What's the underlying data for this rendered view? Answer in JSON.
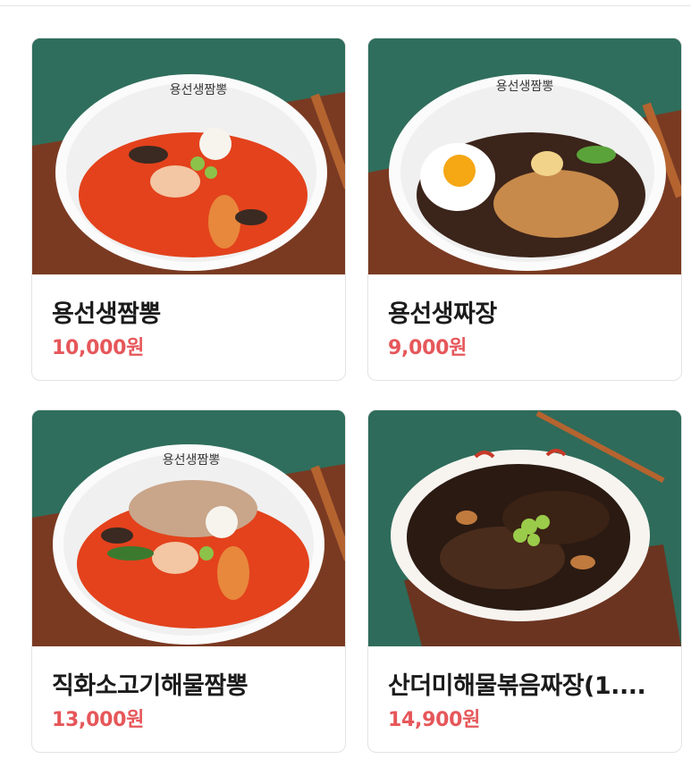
{
  "menu": {
    "items": [
      {
        "name": "용선생짬뽕",
        "price": "10,000원",
        "image": "jjamppong-bowl-image",
        "bowl_logo": "용선생짬뽕"
      },
      {
        "name": "용선생짜장",
        "price": "9,000원",
        "image": "jjajang-bowl-image",
        "bowl_logo": "용선생짬뽕"
      },
      {
        "name": "직화소고기해물짬뽕",
        "price": "13,000원",
        "image": "beef-seafood-jjamppong-image",
        "bowl_logo": "용선생짬뽕"
      },
      {
        "name": "산더미해물볶음짜장(1....",
        "price": "14,900원",
        "image": "seafood-stir-fried-jjajang-image"
      }
    ]
  },
  "colors": {
    "price": "#e6575a",
    "background_green": "#2f6f5e",
    "card_border": "#e3e3e3"
  }
}
